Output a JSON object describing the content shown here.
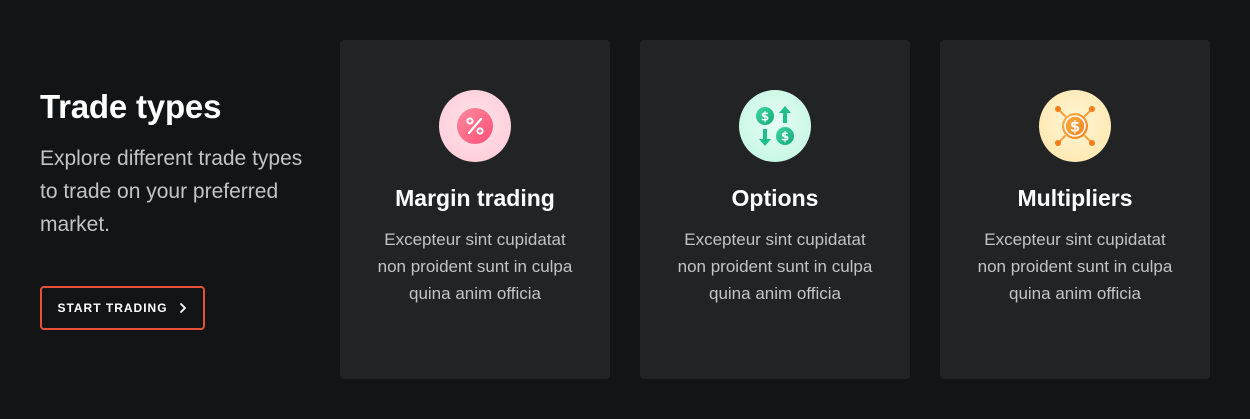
{
  "intro": {
    "title": "Trade types",
    "description": "Explore different trade types to trade on your preferred market.",
    "cta_label": "START TRADING"
  },
  "cards": [
    {
      "title": "Margin trading",
      "description": "Excepteur sint cupidatat non proident sunt in culpa quina anim officia",
      "icon": "percent-icon"
    },
    {
      "title": "Options",
      "description": "Excepteur sint cupidatat non proident sunt in culpa quina anim officia",
      "icon": "options-exchange-icon"
    },
    {
      "title": "Multipliers",
      "description": "Excepteur sint cupidatat non proident sunt in culpa quina anim officia",
      "icon": "multipliers-dollar-icon"
    }
  ],
  "colors": {
    "background": "#131416",
    "card_background": "#222325",
    "accent": "#e8503a"
  }
}
